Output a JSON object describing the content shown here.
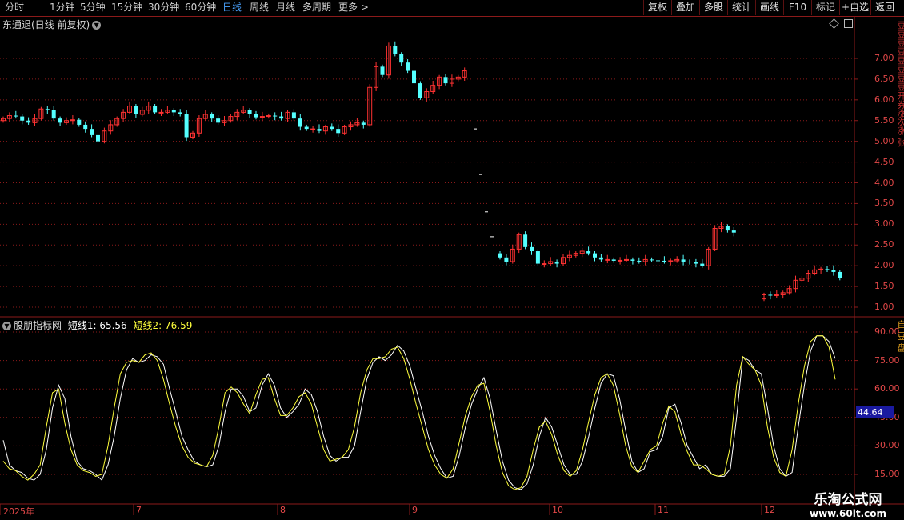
{
  "toolbar": {
    "periods": [
      "分时",
      "1分钟",
      "5分钟",
      "15分钟",
      "30分钟",
      "60分钟",
      "日线",
      "周线",
      "月线",
      "多周期",
      "更多 >"
    ],
    "active_index": 6,
    "right_buttons": [
      "复权",
      "叠加",
      "多股",
      "统计",
      "画线",
      "F10",
      "标记",
      "+自选",
      "返回"
    ]
  },
  "main_title": "东通退(日线 前复权)",
  "right_vertical_text_top": "豆豆豆豆豆豆豆豆开券涨次涨 张",
  "right_vertical_text_bottom": "自 豆 盘",
  "price_axis": [
    "7.00",
    "6.50",
    "6.00",
    "5.50",
    "5.00",
    "4.50",
    "4.00",
    "3.50",
    "3.00",
    "2.50",
    "2.00",
    "1.50",
    "1.00"
  ],
  "indicator": {
    "name": "股朋指标网",
    "line1_label": "短线1: 65.56",
    "line2_label": "短线2: 76.59",
    "axis": [
      "90.00",
      "75.00",
      "60.00",
      "45.00",
      "30.00",
      "15.00"
    ],
    "current_value": "44.64"
  },
  "x_axis": [
    "2025年",
    "7",
    "8",
    "9",
    "10",
    "11",
    "12"
  ],
  "watermark": {
    "name": "乐淘公式网",
    "url": "www.60lt.com"
  },
  "colors": {
    "up": "#ff3232",
    "down": "#54ffff",
    "line1": "#ffffff",
    "line2": "#ffff3c",
    "grid": "#8c1a1a"
  },
  "chart_data": [
    {
      "type": "candlestick",
      "title": "东通退(日线 前复权)",
      "ylim": [
        0.8,
        7.6
      ],
      "x_ticks": [
        "2025年",
        "7",
        "8",
        "9",
        "10",
        "11",
        "12"
      ],
      "segment1_closes": [
        5.55,
        5.62,
        5.6,
        5.5,
        5.45,
        5.55,
        5.78,
        5.75,
        5.55,
        5.45,
        5.5,
        5.52,
        5.4,
        5.3,
        5.15,
        5.0,
        5.25,
        5.4,
        5.55,
        5.7,
        5.85,
        5.65,
        5.75,
        5.85,
        5.7,
        5.7,
        5.75,
        5.7,
        5.65,
        5.1,
        5.2,
        5.55,
        5.65,
        5.55,
        5.45,
        5.5,
        5.6,
        5.7,
        5.75,
        5.65,
        5.58,
        5.6,
        5.62,
        5.6,
        5.55,
        5.7,
        5.55,
        5.35,
        5.3,
        5.3,
        5.25,
        5.35,
        5.3,
        5.2,
        5.35,
        5.4,
        5.45,
        5.4,
        6.3,
        6.8,
        6.6,
        7.3,
        7.1,
        6.9,
        6.7,
        6.4,
        6.05,
        6.2,
        6.35,
        6.55,
        6.4,
        6.5,
        6.55,
        6.7
      ],
      "gap_levels": [
        5.3,
        4.2,
        3.3,
        2.7
      ],
      "segment2_closes": [
        2.2,
        2.1,
        2.4,
        2.75,
        2.45,
        2.35,
        2.05,
        2.05,
        2.1,
        2.05,
        2.2,
        2.25,
        2.3,
        2.35,
        2.3,
        2.2,
        2.15,
        2.15,
        2.12,
        2.13,
        2.15,
        2.12,
        2.1,
        2.15,
        2.13,
        2.12,
        2.1,
        2.12,
        2.15,
        2.1,
        2.08,
        2.05,
        2.0,
        2.4,
        2.9,
        2.95,
        2.85,
        2.8
      ],
      "segment3_closes": [
        1.3,
        1.28,
        1.3,
        1.35,
        1.45,
        1.65,
        1.7,
        1.82,
        1.9,
        1.92,
        1.9,
        1.85,
        1.7
      ]
    },
    {
      "type": "line",
      "title": "股朋指标网",
      "ylim": [
        5,
        97
      ],
      "series": [
        {
          "name": "短线1",
          "values": [
            33,
            20,
            17,
            16,
            13,
            12,
            15,
            28,
            50,
            62,
            55,
            35,
            22,
            18,
            17,
            15,
            12,
            20,
            35,
            55,
            70,
            76,
            74,
            75,
            78,
            77,
            73,
            60,
            48,
            35,
            28,
            22,
            20,
            19,
            20,
            30,
            48,
            60,
            60,
            56,
            48,
            50,
            62,
            68,
            62,
            50,
            45,
            48,
            52,
            60,
            57,
            48,
            35,
            25,
            22,
            24,
            24,
            30,
            48,
            65,
            74,
            77,
            75,
            78,
            83,
            80,
            72,
            60,
            48,
            35,
            25,
            18,
            13,
            14,
            25,
            40,
            52,
            60,
            66,
            55,
            38,
            22,
            12,
            8,
            7,
            10,
            20,
            35,
            45,
            40,
            30,
            20,
            15,
            15,
            22,
            35,
            50,
            63,
            68,
            67,
            55,
            38,
            22,
            16,
            18,
            27,
            28,
            35,
            50,
            52,
            42,
            30,
            24,
            18,
            20,
            15,
            14,
            14,
            18,
            45,
            77,
            75,
            70,
            68,
            50,
            30,
            18,
            14,
            16,
            40,
            62,
            80,
            88,
            88,
            85,
            76
          ]
        },
        {
          "name": "短线2",
          "values": [
            22,
            18,
            17,
            14,
            12,
            15,
            20,
            40,
            58,
            60,
            42,
            28,
            20,
            17,
            16,
            14,
            15,
            30,
            50,
            68,
            74,
            75,
            74,
            78,
            79,
            75,
            65,
            52,
            40,
            30,
            24,
            21,
            20,
            19,
            25,
            40,
            58,
            61,
            58,
            52,
            47,
            57,
            65,
            66,
            55,
            46,
            46,
            50,
            56,
            58,
            52,
            40,
            28,
            22,
            23,
            24,
            28,
            40,
            58,
            70,
            76,
            76,
            77,
            81,
            82,
            76,
            65,
            52,
            40,
            28,
            20,
            15,
            13,
            18,
            32,
            46,
            56,
            62,
            63,
            48,
            30,
            16,
            9,
            7,
            8,
            14,
            28,
            40,
            43,
            36,
            25,
            17,
            14,
            17,
            28,
            43,
            57,
            66,
            68,
            62,
            47,
            30,
            19,
            16,
            22,
            28,
            30,
            42,
            51,
            48,
            36,
            27,
            20,
            20,
            18,
            15,
            14,
            15,
            30,
            62,
            77,
            73,
            70,
            62,
            40,
            24,
            16,
            14,
            28,
            52,
            72,
            85,
            88,
            88,
            82,
            65
          ]
        }
      ]
    }
  ]
}
